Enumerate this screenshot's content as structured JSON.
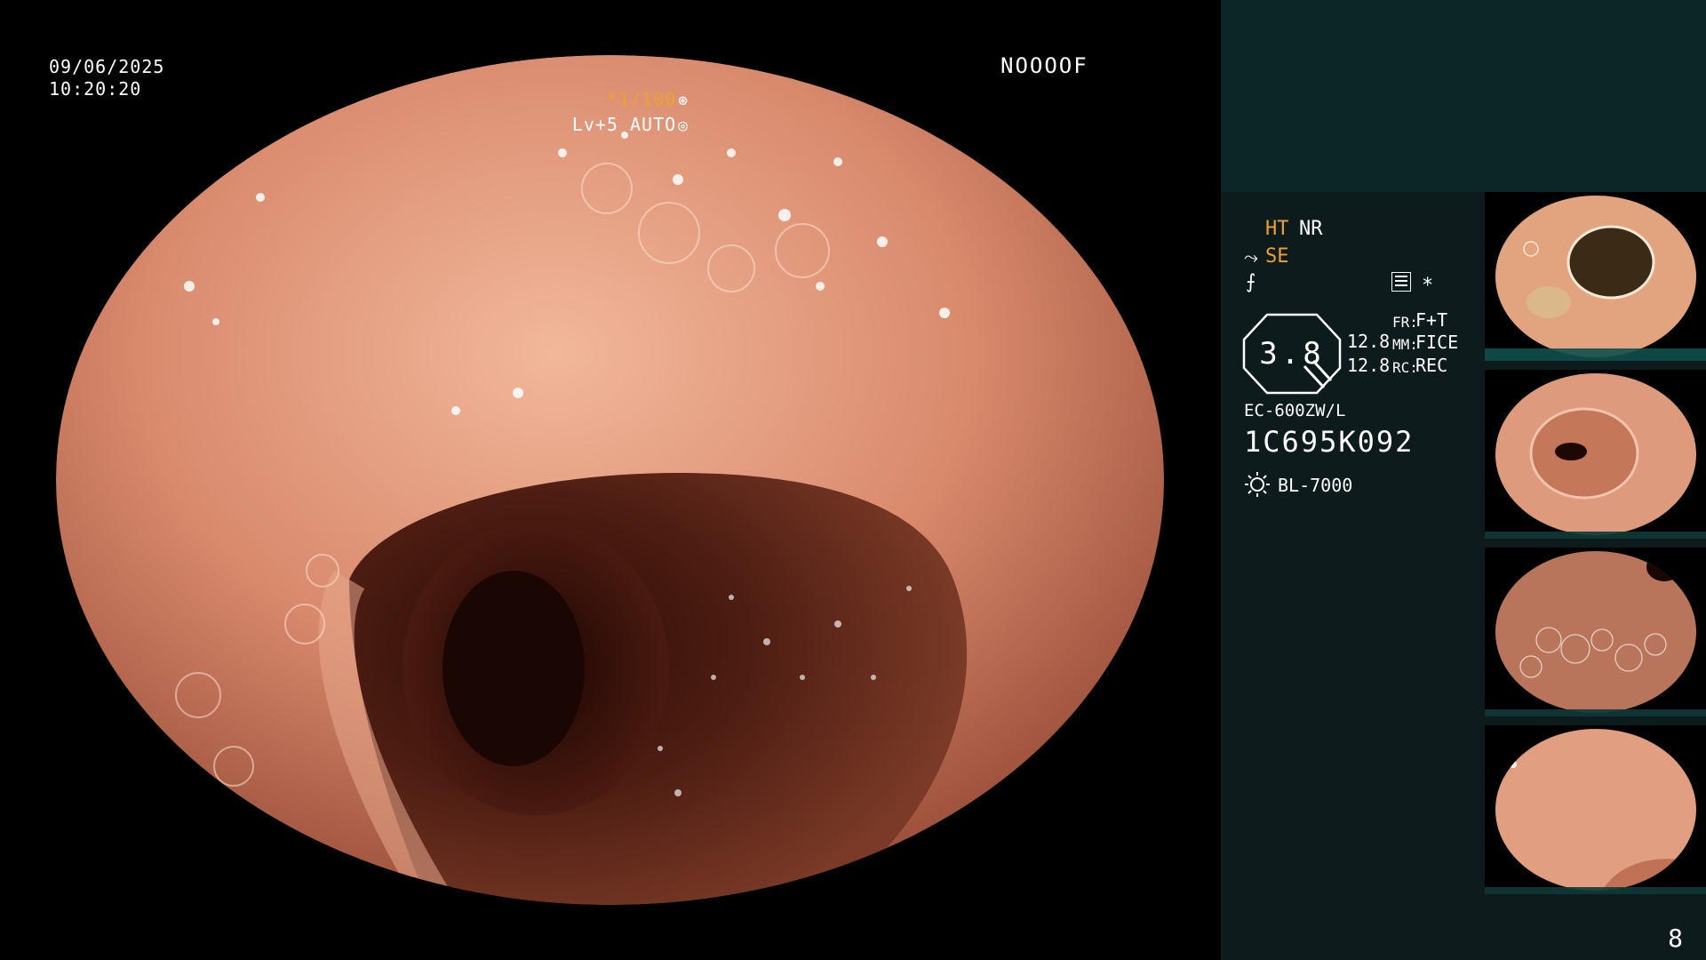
{
  "overlay": {
    "date": "09/06/2025",
    "time": "10:20:20",
    "scope_id": "NOOOOF",
    "shutter": "*1/100",
    "level": "Lv+5 AUTO",
    "shutter_icon": "aperture-icon",
    "level_icon": "iris-icon"
  },
  "panel": {
    "ht": "HT",
    "nr": "NR",
    "se": "SE",
    "se_icon": "structure-enhance-icon",
    "f_icon": "filter-icon",
    "lines_icon": "settings-list-icon",
    "star": "*",
    "zoom_value": "3.8",
    "value_1": "12.8",
    "value_2": "12.8",
    "fr_label": "FR:",
    "fr_value": "F+T",
    "mm_label": "MM:",
    "mm_value": "FICE",
    "rc_label": "RC:",
    "rc_value": "REC",
    "scope_model": "EC-600ZW/L",
    "scope_serial": "1C695K092",
    "light_icon": "light-source-icon",
    "light_source": "BL-7000",
    "accent_color": "#f0a030"
  },
  "thumbnails": {
    "count": 4
  },
  "page_number": "8"
}
